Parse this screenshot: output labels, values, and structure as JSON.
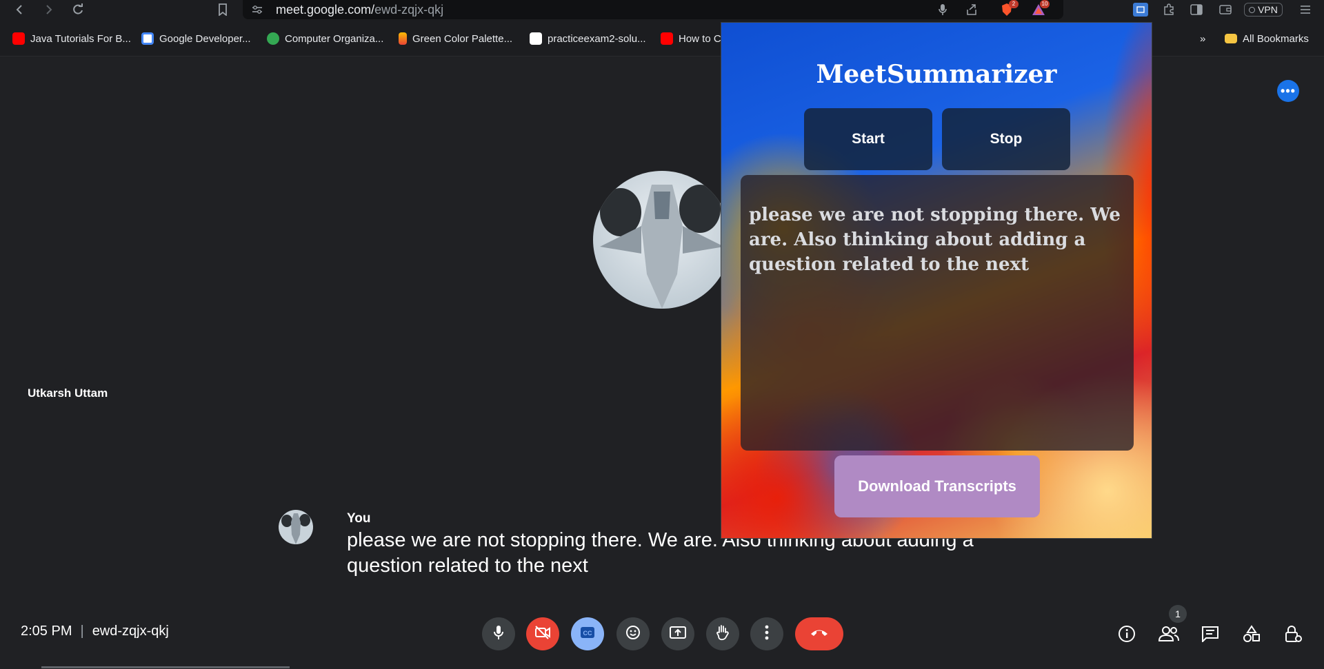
{
  "browser": {
    "url_host": "meet.google.com/",
    "url_path": "ewd-zqjx-qkj",
    "brave_badge": "2",
    "ext_badge": "10",
    "vpn_label": "VPN"
  },
  "bookmarks": {
    "items": [
      {
        "label": "Java Tutorials For B...",
        "color": "#ff0000"
      },
      {
        "label": "Google Developer...",
        "color": "#ffffff"
      },
      {
        "label": "Computer Organiza...",
        "color": "#34a853"
      },
      {
        "label": "Green Color Palette...",
        "color": "#fbbc04"
      },
      {
        "label": "practiceexam2-solu...",
        "color": "#ffffff"
      },
      {
        "label": "How to C",
        "color": "#ff0000"
      }
    ],
    "overflow_label": "»",
    "all_bookmarks_label": "All Bookmarks"
  },
  "meet": {
    "participant_name": "Utkarsh Uttam",
    "caption": {
      "speaker": "You",
      "text": "please we are not stopping there. We are. Also thinking about adding a question related to the next"
    },
    "time": "2:05 PM",
    "separator": "|",
    "meeting_code": "ewd-zqjx-qkj",
    "people_count": "1",
    "colors": {
      "hangup": "#ea4335",
      "captions_active": "#8ab4f8",
      "accent": "#1a73e8"
    }
  },
  "extension": {
    "title": "MeetSummarizer",
    "start_label": "Start",
    "stop_label": "Stop",
    "transcript": "please we are not stopping there. We are. Also thinking about adding a question related to the next",
    "download_label": "Download Transcripts"
  }
}
